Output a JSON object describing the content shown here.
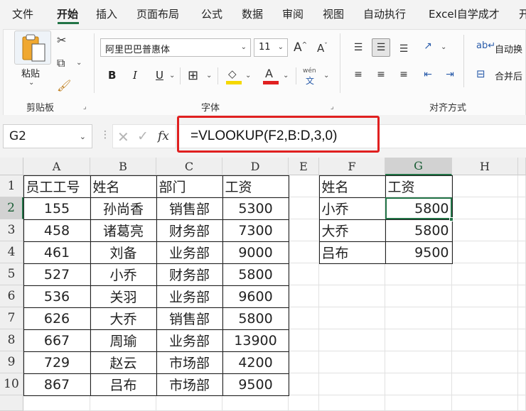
{
  "menu": {
    "tabs": [
      "文件",
      "开始",
      "插入",
      "页面布局",
      "公式",
      "数据",
      "审阅",
      "视图",
      "自动执行",
      "Excel自学成才",
      "开"
    ],
    "active": "开始"
  },
  "ribbon": {
    "clipboard": {
      "group_label": "剪贴板",
      "paste_label": "粘贴"
    },
    "font": {
      "group_label": "字体",
      "font_name": "阿里巴巴普惠体",
      "font_size": "11",
      "grow": "A",
      "shrink": "A",
      "bold": "B",
      "italic": "I",
      "underline": "U",
      "phonetic_top": "wén",
      "phonetic_bottom": "文"
    },
    "alignment": {
      "group_label": "对齐方式",
      "wrap_text": "自动换",
      "merge_center": "合并后"
    }
  },
  "formula_bar": {
    "name_box": "G2",
    "formula": "=VLOOKUP(F2,B:D,3,0)",
    "fx": "fx"
  },
  "columns": [
    "A",
    "B",
    "C",
    "D",
    "E",
    "F",
    "G",
    "H"
  ],
  "selected_column": "G",
  "rows": [
    "1",
    "2",
    "3",
    "4",
    "5",
    "6",
    "7",
    "8",
    "9",
    "10"
  ],
  "selected_row": "2",
  "table_main": {
    "headers": [
      "员工工号",
      "姓名",
      "部门",
      "工资"
    ],
    "rows": [
      [
        "155",
        "孙尚香",
        "销售部",
        "5300"
      ],
      [
        "458",
        "诸葛亮",
        "财务部",
        "7300"
      ],
      [
        "461",
        "刘备",
        "业务部",
        "9000"
      ],
      [
        "527",
        "小乔",
        "财务部",
        "5800"
      ],
      [
        "536",
        "关羽",
        "业务部",
        "9600"
      ],
      [
        "626",
        "大乔",
        "销售部",
        "5800"
      ],
      [
        "667",
        "周瑜",
        "业务部",
        "13900"
      ],
      [
        "729",
        "赵云",
        "市场部",
        "4200"
      ],
      [
        "867",
        "吕布",
        "市场部",
        "9500"
      ]
    ]
  },
  "table_lookup": {
    "headers": [
      "姓名",
      "工资"
    ],
    "rows": [
      [
        "小乔",
        "5800"
      ],
      [
        "大乔",
        "5800"
      ],
      [
        "吕布",
        "9500"
      ]
    ]
  },
  "colors": {
    "accent": "#217346",
    "highlight_box": "#e02020",
    "fill_yellow": "#f5d800",
    "font_red": "#e02020"
  }
}
